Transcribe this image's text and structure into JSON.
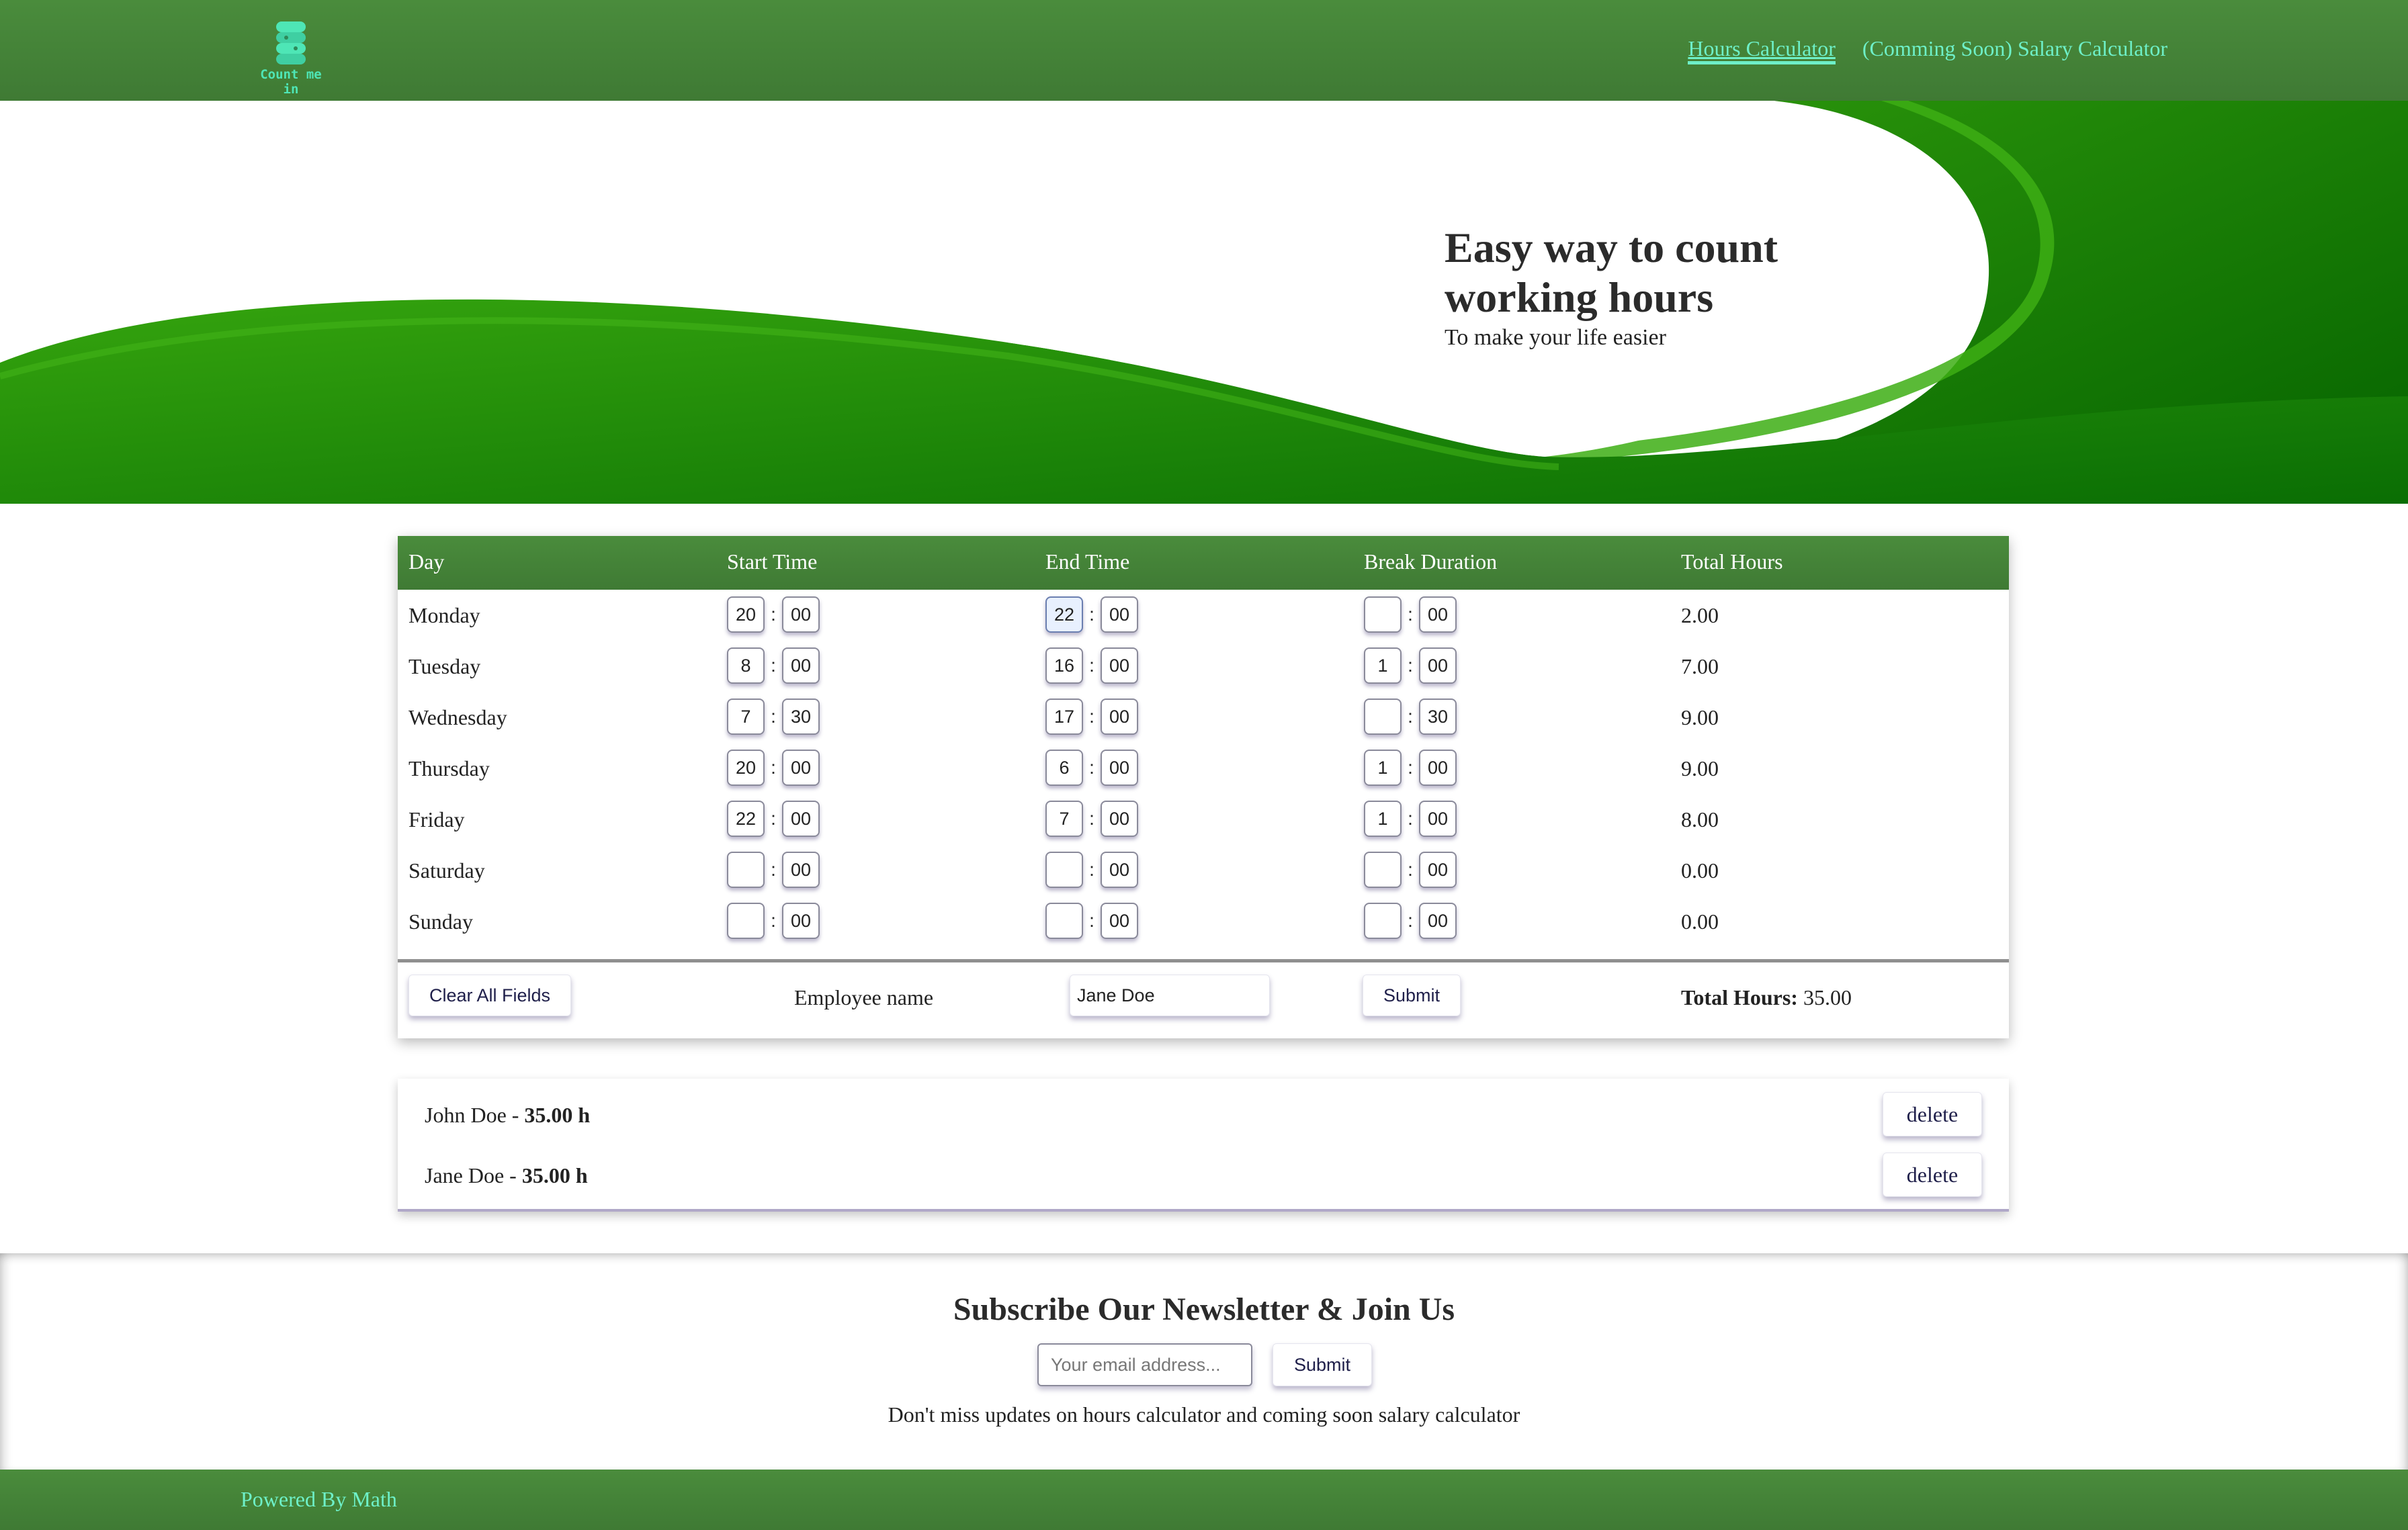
{
  "brand": {
    "logo_text": "Count me in"
  },
  "nav": {
    "hours_calculator": "Hours Calculator",
    "salary_calculator": "(Comming Soon) Salary Calculator"
  },
  "hero": {
    "title": "Easy way to count working hours",
    "subtitle": "To make your life easier"
  },
  "table": {
    "headers": {
      "day": "Day",
      "start": "Start Time",
      "end": "End Time",
      "break": "Break Duration",
      "total": "Total Hours"
    },
    "separator": ":",
    "rows": [
      {
        "day": "Monday",
        "start_h": "20",
        "start_m": "00",
        "end_h": "22",
        "end_m": "00",
        "break_h": "",
        "break_m": "00",
        "total": "2.00"
      },
      {
        "day": "Tuesday",
        "start_h": "8",
        "start_m": "00",
        "end_h": "16",
        "end_m": "00",
        "break_h": "1",
        "break_m": "00",
        "total": "7.00"
      },
      {
        "day": "Wednesday",
        "start_h": "7",
        "start_m": "30",
        "end_h": "17",
        "end_m": "00",
        "break_h": "",
        "break_m": "30",
        "total": "9.00"
      },
      {
        "day": "Thursday",
        "start_h": "20",
        "start_m": "00",
        "end_h": "6",
        "end_m": "00",
        "break_h": "1",
        "break_m": "00",
        "total": "9.00"
      },
      {
        "day": "Friday",
        "start_h": "22",
        "start_m": "00",
        "end_h": "7",
        "end_m": "00",
        "break_h": "1",
        "break_m": "00",
        "total": "8.00"
      },
      {
        "day": "Saturday",
        "start_h": "",
        "start_m": "00",
        "end_h": "",
        "end_m": "00",
        "break_h": "",
        "break_m": "00",
        "total": "0.00"
      },
      {
        "day": "Sunday",
        "start_h": "",
        "start_m": "00",
        "end_h": "",
        "end_m": "00",
        "break_h": "",
        "break_m": "00",
        "total": "0.00"
      }
    ],
    "focused_field": "Monday end hour"
  },
  "form": {
    "clear_label": "Clear All Fields",
    "employee_label": "Employee name",
    "employee_value": "Jane Doe",
    "submit_label": "Submit",
    "total_label": "Total Hours:",
    "total_value": "35.00"
  },
  "saved": [
    {
      "name": "John Doe",
      "separator": " - ",
      "hours": "35.00 h",
      "delete_label": "delete"
    },
    {
      "name": "Jane Doe",
      "separator": " - ",
      "hours": "35.00 h",
      "delete_label": "delete"
    }
  ],
  "newsletter": {
    "title": "Subscribe Our Newsletter & Join Us",
    "email_placeholder": "Your email address...",
    "submit_label": "Submit",
    "note": "Don't miss updates on hours calculator and coming soon salary calculator"
  },
  "footer": {
    "powered": "Powered By Math"
  },
  "colors": {
    "header_green": "#4a8c3c",
    "accent_mint": "#6ef0c8",
    "wave_green": "#2f9a0c"
  },
  "icons": {
    "logo": "stacked-coins-icon"
  }
}
